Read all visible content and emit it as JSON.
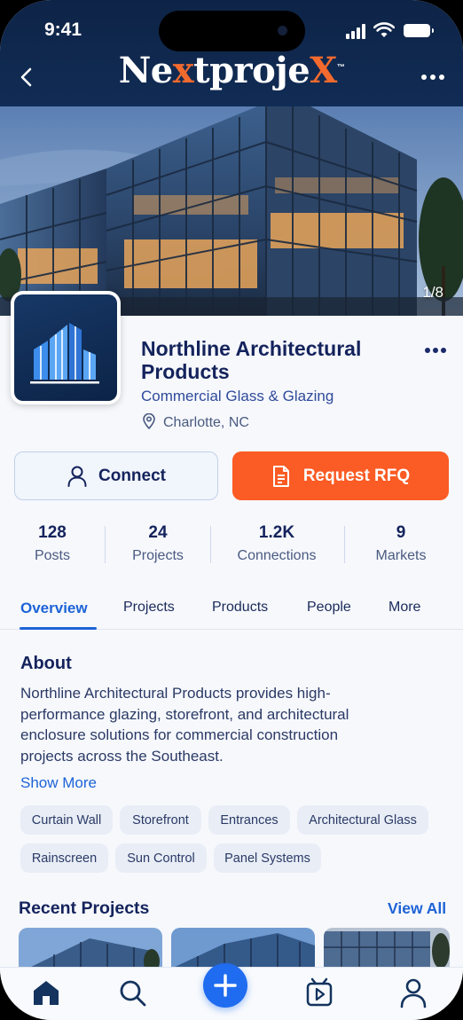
{
  "status_bar": {
    "time": "9:41"
  },
  "header": {
    "logo_pre": "Ne",
    "logo_x1": "x",
    "logo_mid": "tproje",
    "logo_x2": "X",
    "logo_tm": "™",
    "back_icon": "chevron-left-icon",
    "more_icon": "more-horizontal-icon"
  },
  "hero": {
    "image_counter": "1/8"
  },
  "company": {
    "name": "Northline Architectural Products",
    "category": "Commercial Glass & Glazing",
    "location": "Charlotte, NC"
  },
  "actions": {
    "connect_label": "Connect",
    "rfq_label": "Request RFQ"
  },
  "stats": [
    {
      "value": "128",
      "label": "Posts"
    },
    {
      "value": "24",
      "label": "Projects"
    },
    {
      "value": "1.2K",
      "label": "Connections"
    },
    {
      "value": "9",
      "label": "Markets"
    }
  ],
  "tabs": [
    {
      "label": "Overview",
      "active": true
    },
    {
      "label": "Projects"
    },
    {
      "label": "Products"
    },
    {
      "label": "People"
    },
    {
      "label": "More"
    }
  ],
  "about": {
    "title": "About",
    "text": "Northline Architectural  Products provides high-performance glazing, storefront, and architectural enclosure solutions for commercial  construction projects across the Southeast.",
    "show_more": "Show More"
  },
  "chips": [
    "Curtain Wall",
    "Storefront",
    "Entrances",
    "Architectural Glass",
    "Rainscreen",
    "Sun Control",
    "Panel Systems"
  ],
  "recent_projects": {
    "title": "Recent Projects",
    "view_all": "View All"
  },
  "bottom_nav": [
    "home-icon",
    "search-icon",
    "plus-icon",
    "video-icon",
    "profile-icon"
  ],
  "colors": {
    "navy": "#14235c",
    "accent_blue": "#1d63d6",
    "orange": "#fb5b24",
    "header_bg": "#0e2447"
  }
}
